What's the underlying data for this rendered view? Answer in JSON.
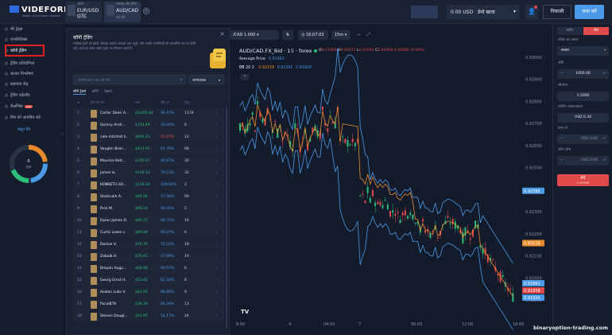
{
  "header": {
    "logo": "VIDEFOREX",
    "logo_subtitle": "BINARY, CFD & FOREX TRADING",
    "tabs": [
      {
        "top": "ऑफर",
        "name": "EUR/USD OTC",
        "value": "$0.00"
      },
      {
        "top": "क्लाउड और ट्रेडिंग",
        "name": "AUD/CAD",
        "value": "$0.00"
      }
    ],
    "balance": "0.00 USD",
    "balance_label": "डेमो खाता",
    "withdraw_label": "निकासी",
    "deposit_label": "जमा करें"
  },
  "sidebar": {
    "items": [
      {
        "icon": "◎",
        "label": "मेरे ट्रेड्स"
      },
      {
        "icon": "◎",
        "label": "एनालिटिक्स"
      },
      {
        "icon": "◎",
        "label": "कॉपी ट्रेडिंग"
      },
      {
        "icon": "◎",
        "label": "ट्रेडिंग प्रतियोगिता"
      },
      {
        "icon": "◎",
        "label": "बाज़ार विश्लेषण"
      },
      {
        "icon": "◎",
        "label": "सहायता केंद्र"
      },
      {
        "icon": "◎",
        "label": "ट्रेडिंग वर्कशीट"
      },
      {
        "icon": "◎",
        "label": "शैक्षणिक"
      },
      {
        "icon": "◎",
        "label": "मित्र को आमंत्रित करें"
      }
    ],
    "badge": "New",
    "sale_label": "सबूत बैंड",
    "donut_value": "0",
    "donut_label": "ट्रेड्स"
  },
  "copy_panel": {
    "title": "कॉपी ट्रेडिंग",
    "description": "सर्वश्रेष्ठ ट्रेडर्स को खोजें, विस्तृत प्रदर्शन आंकड़ों तक पहुंचें, और उनकी रणनीतियों को स्वचालित रूप से कॉपी करें। आप हर समय अपने ट्रेड्स पर नियंत्रण रखते हैं।",
    "search_placeholder": "उपयोगकर्ता नाम दर्ज करें",
    "sort_label": "लाभदायक",
    "tabs": [
      "सीर्ष ट्रेडर्स",
      "कॉपी",
      "देखना"
    ],
    "columns": [
      "#",
      "ट्रेडर का नाम",
      "लाभ",
      "जीत दर",
      "ट्रेड्स"
    ],
    "traders": [
      {
        "rank": "1",
        "name": "Carter Dean A...",
        "profit": "$3,042.84",
        "win": "46.47%",
        "trades": "1176",
        "neg": false
      },
      {
        "rank": "2",
        "name": "Quincy Andr...",
        "profit": "$724.49",
        "win": "50.00%",
        "trades": "6",
        "neg": false
      },
      {
        "rank": "3",
        "name": "cole mitchell k.",
        "profit": "$604.23",
        "win": "41.67%",
        "trades": "12",
        "neg": true
      },
      {
        "rank": "4",
        "name": "Vaughn Bran...",
        "profit": "$413.95",
        "win": "61.76%",
        "trades": "68",
        "neg": false
      },
      {
        "rank": "5",
        "name": "Maurice Keit...",
        "profit": "$150.07",
        "win": "46.67%",
        "trades": "30",
        "neg": false
      },
      {
        "rank": "6",
        "name": "james w.",
        "profit": "$149.12",
        "win": "78.13%",
        "trades": "32",
        "neg": false
      },
      {
        "rank": "7",
        "name": "KENNETH SH...",
        "profit": "$138.10",
        "win": "100.00%",
        "trades": "2",
        "neg": false
      },
      {
        "rank": "8",
        "name": "Shahrukh A.",
        "profit": "$99.56",
        "win": "57.58%",
        "trades": "99",
        "neg": false
      },
      {
        "rank": "9",
        "name": "Rick M.",
        "profit": "$98.50",
        "win": "80.00%",
        "trades": "5",
        "neg": false
      },
      {
        "rank": "10",
        "name": "Dylan James D.",
        "profit": "$95.23",
        "win": "68.75%",
        "trades": "16",
        "neg": false
      },
      {
        "rank": "11",
        "name": "Curtis Lewis c.",
        "profit": "$84.88",
        "win": "66.67%",
        "trades": "6",
        "neg": false
      },
      {
        "rank": "12",
        "name": "Denise V.",
        "profit": "$76.76",
        "win": "72.22%",
        "trades": "18",
        "neg": false
      },
      {
        "rank": "13",
        "name": "Zobaib H.",
        "profit": "$76.65",
        "win": "57.89%",
        "trades": "19",
        "neg": false
      },
      {
        "rank": "14",
        "name": "Brayan Augu...",
        "profit": "$68.08",
        "win": "66.67%",
        "trades": "6",
        "neg": false
      },
      {
        "rank": "15",
        "name": "Georg Ernst H.",
        "profit": "$53.82",
        "win": "62.50%",
        "trades": "8",
        "neg": false
      },
      {
        "rank": "16",
        "name": "Avalon Luke V.",
        "profit": "$42.05",
        "win": "88.89%",
        "trades": "9",
        "neg": false
      },
      {
        "rank": "17",
        "name": "fiscal876",
        "profit": "$39.36",
        "win": "64.29%",
        "trades": "13",
        "neg": false
      },
      {
        "rank": "18",
        "name": "Steven Dougl...",
        "profit": "$22.95",
        "win": "54.17%",
        "trades": "24",
        "neg": false
      }
    ]
  },
  "chart_toolbar": {
    "asset": "/CAD 1.000",
    "time": "16:07:03",
    "interval": "15m"
  },
  "chart": {
    "title": "AUD/CAD.FX_Bid · 15 · forex",
    "ohlc": {
      "o": "0.91959",
      "h": "0.91971",
      "l": "0.91954",
      "c": "0.91958",
      "chg": "0.00000 (0.00%)"
    },
    "avg_price_label": "Average Price",
    "avg_price": "0.91961",
    "bb_label": "BB 20 2",
    "bb_values": [
      "0.92158",
      "0.92395",
      "0.91920"
    ],
    "price_ticks": [
      "0.93000",
      "0.92900",
      "0.92800",
      "0.92700",
      "0.92600",
      "0.92500",
      "0.92400",
      "0.92300",
      "0.92200",
      "0.92100",
      "0.92000",
      "0.91900"
    ],
    "price_tags": [
      {
        "value": "0.92395",
        "color": "#4a9ae8"
      },
      {
        "value": "0.92158",
        "color": "#e88a2a"
      },
      {
        "value": "0.91961",
        "color": "#4a9ae8"
      },
      {
        "value": "0.91958",
        "color": "#e04a4a"
      },
      {
        "value": "0.91920",
        "color": "#4a9ae8"
      }
    ],
    "time_ticks": [
      "8:00",
      "4",
      "04:00",
      "7",
      "06:00",
      "12:00",
      "18:00"
    ],
    "brand": "TV"
  },
  "order_panel": {
    "tab_buy": "खरीद",
    "tab_sell": "सेल",
    "order_type_label": "ऑर्डर का प्रकार",
    "order_type": "बाज़ार",
    "amount_label": "राशि",
    "amount": "1000.00",
    "leverage_label": "लीवरेज",
    "leverage": "1:2000",
    "margin_label": "मार्जिन आवश्यकता",
    "margin": "USD 0.34",
    "take_profit_label": "लाभ लें",
    "take_profit": "USD 0.00",
    "stop_loss_label": "स्टॉप लॉस",
    "stop_loss": "USD 0.00",
    "sell_label": "बेचें",
    "sell_price": "0.91958"
  },
  "watermark": "binaryoption-trading.com"
}
